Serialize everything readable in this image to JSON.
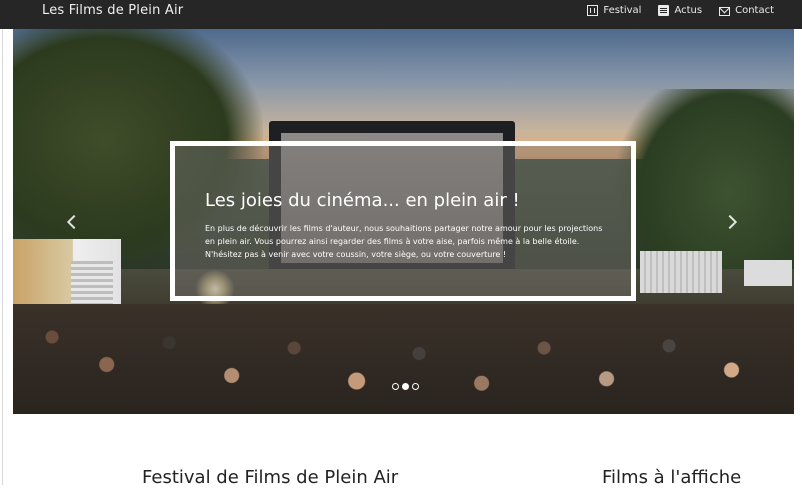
{
  "navbar": {
    "brand": "Les Films de Plein Air",
    "items": [
      {
        "label": "Festival",
        "icon": "film-icon"
      },
      {
        "label": "Actus",
        "icon": "newspaper-icon"
      },
      {
        "label": "Contact",
        "icon": "envelope-icon"
      }
    ]
  },
  "carousel": {
    "caption_title": "Les joies du cinéma... en plein air !",
    "caption_text": "En plus de découvrir les films d'auteur, nous souhaitions partager notre amour pour les projections en plein air. Vous pourrez ainsi regarder des films à votre aise, parfois même à la belle étoile. N'hésitez pas à venir avec votre coussin, votre siège, ou votre couverture !",
    "slide_count": 3,
    "active_slide": 1,
    "prev_icon": "chevron-left-icon",
    "next_icon": "chevron-right-icon"
  },
  "sections": {
    "left_heading": "Festival de Films de Plein Air",
    "right_heading": "Films à l'affiche"
  },
  "colors": {
    "navbar_bg": "#262626",
    "caption_border": "#ffffff"
  }
}
